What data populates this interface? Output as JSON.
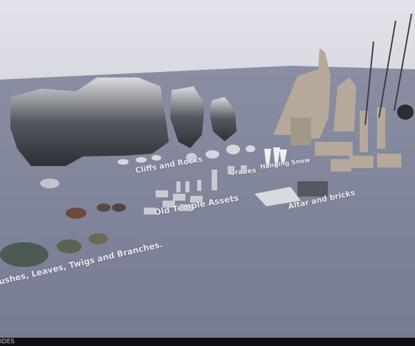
{
  "viewport": {
    "labels": {
      "cliffs": "Cliffs and Rocks",
      "graves": "Graves",
      "hanging_snow": "Hanging Snow",
      "temple": "Old Temple Assets",
      "altar": "Altar and bricks",
      "bushes": "ushes, Leaves, Twigs and Branches."
    }
  },
  "statusbar": {
    "text": "IDES"
  },
  "colors": {
    "sky_top": "#dfe0e8",
    "sky_bottom": "#b6b8c8",
    "floor": "#7b8096",
    "statusbar": "#101012"
  }
}
